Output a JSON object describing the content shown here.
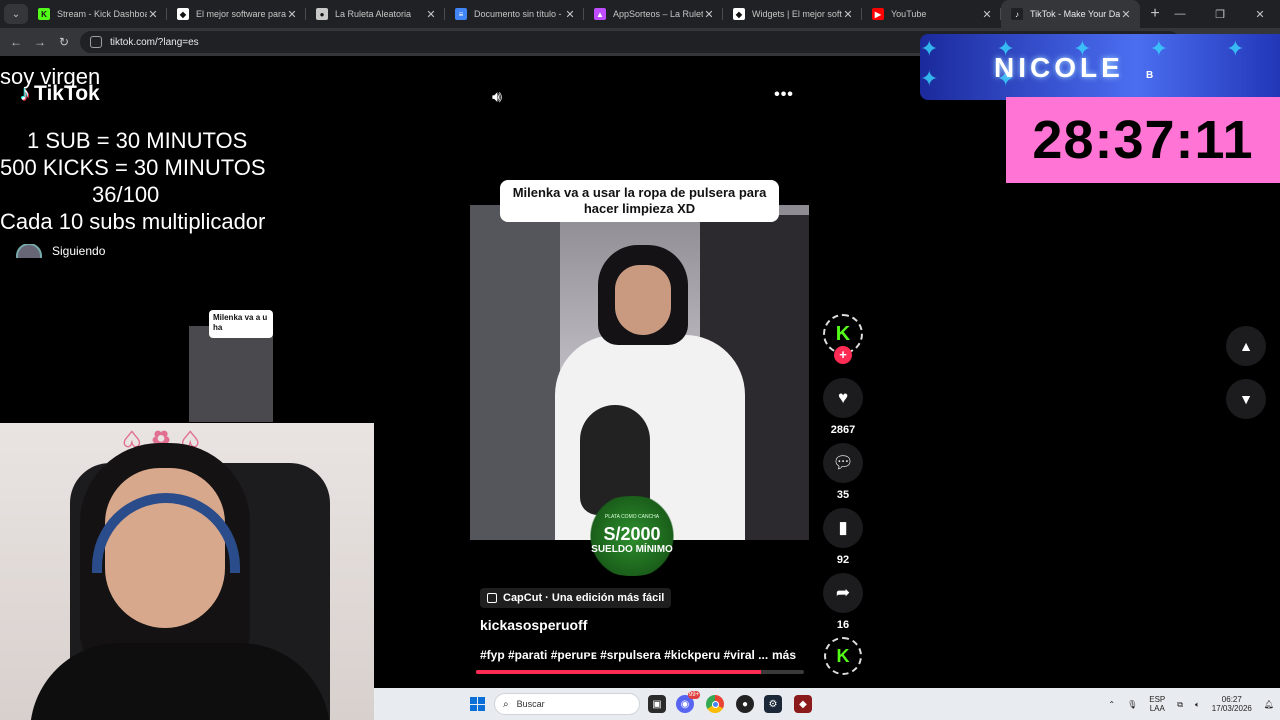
{
  "browser": {
    "tabs": [
      {
        "title": "Stream - Kick Dashboard",
        "favicon": "kick-icon",
        "color": "#53fc18",
        "glyph": "K"
      },
      {
        "title": "El mejor software para po",
        "favicon": "diamond-icon",
        "color": "#ffffff",
        "glyph": "◆"
      },
      {
        "title": "La Ruleta Aleatoria",
        "favicon": "wheel-icon",
        "color": "#c9c9c9",
        "glyph": "●"
      },
      {
        "title": "Documento sin título - Do",
        "favicon": "docs-icon",
        "color": "#4285f4",
        "glyph": "≡"
      },
      {
        "title": "AppSorteos – La Ruleta d",
        "favicon": "appsorteos-icon",
        "color": "#c04cff",
        "glyph": "▲"
      },
      {
        "title": "Widgets | El mejor softwa",
        "favicon": "diamond-icon",
        "color": "#ffffff",
        "glyph": "◆"
      },
      {
        "title": "YouTube",
        "favicon": "youtube-icon",
        "color": "#ff0000",
        "glyph": "▶"
      },
      {
        "title": "TikTok - Make Your Day",
        "favicon": "tiktok-icon",
        "color": "#202124",
        "glyph": "♪"
      }
    ],
    "url": "tiktok.com/?lang=es"
  },
  "stream_overlay": {
    "line1": "soy virgen",
    "line2": "1 SUB      = 30 MINUTOS",
    "line3": "500 KICKS = 30 MINUTOS",
    "line4": "36/100",
    "line5": "Cada 10 subs multiplicador",
    "banner_name": "NICOLE",
    "banner_sub": "B",
    "timer": "28:37:11"
  },
  "tiktok": {
    "logo": "TikTok",
    "following_label": "Siguiendo",
    "mini_caption": "Milenka va a u ha",
    "video_caption": "Milenka va a usar la ropa de pulsera para hacer limpieza XD",
    "badge_top": "PLATA COMO CANCHA",
    "badge_amount": "S/2000",
    "badge_label": "SUELDO MÍNIMO",
    "capcut": "CapCut · Una edición más fácil",
    "author": "kickasosperuoff",
    "hashtags": "#fyp #parati #peruᴘᴇ #srpulsera #kickperu #viral ...",
    "more": "más",
    "likes": "2867",
    "comments": "35",
    "saves": "92",
    "shares": "16",
    "progress": 0.87
  },
  "taskbar": {
    "search_placeholder": "Buscar",
    "lang_top": "ESP",
    "lang_bottom": "LAA",
    "time": "06:27",
    "date": "17/03/2026",
    "notification_badge": "99+"
  }
}
